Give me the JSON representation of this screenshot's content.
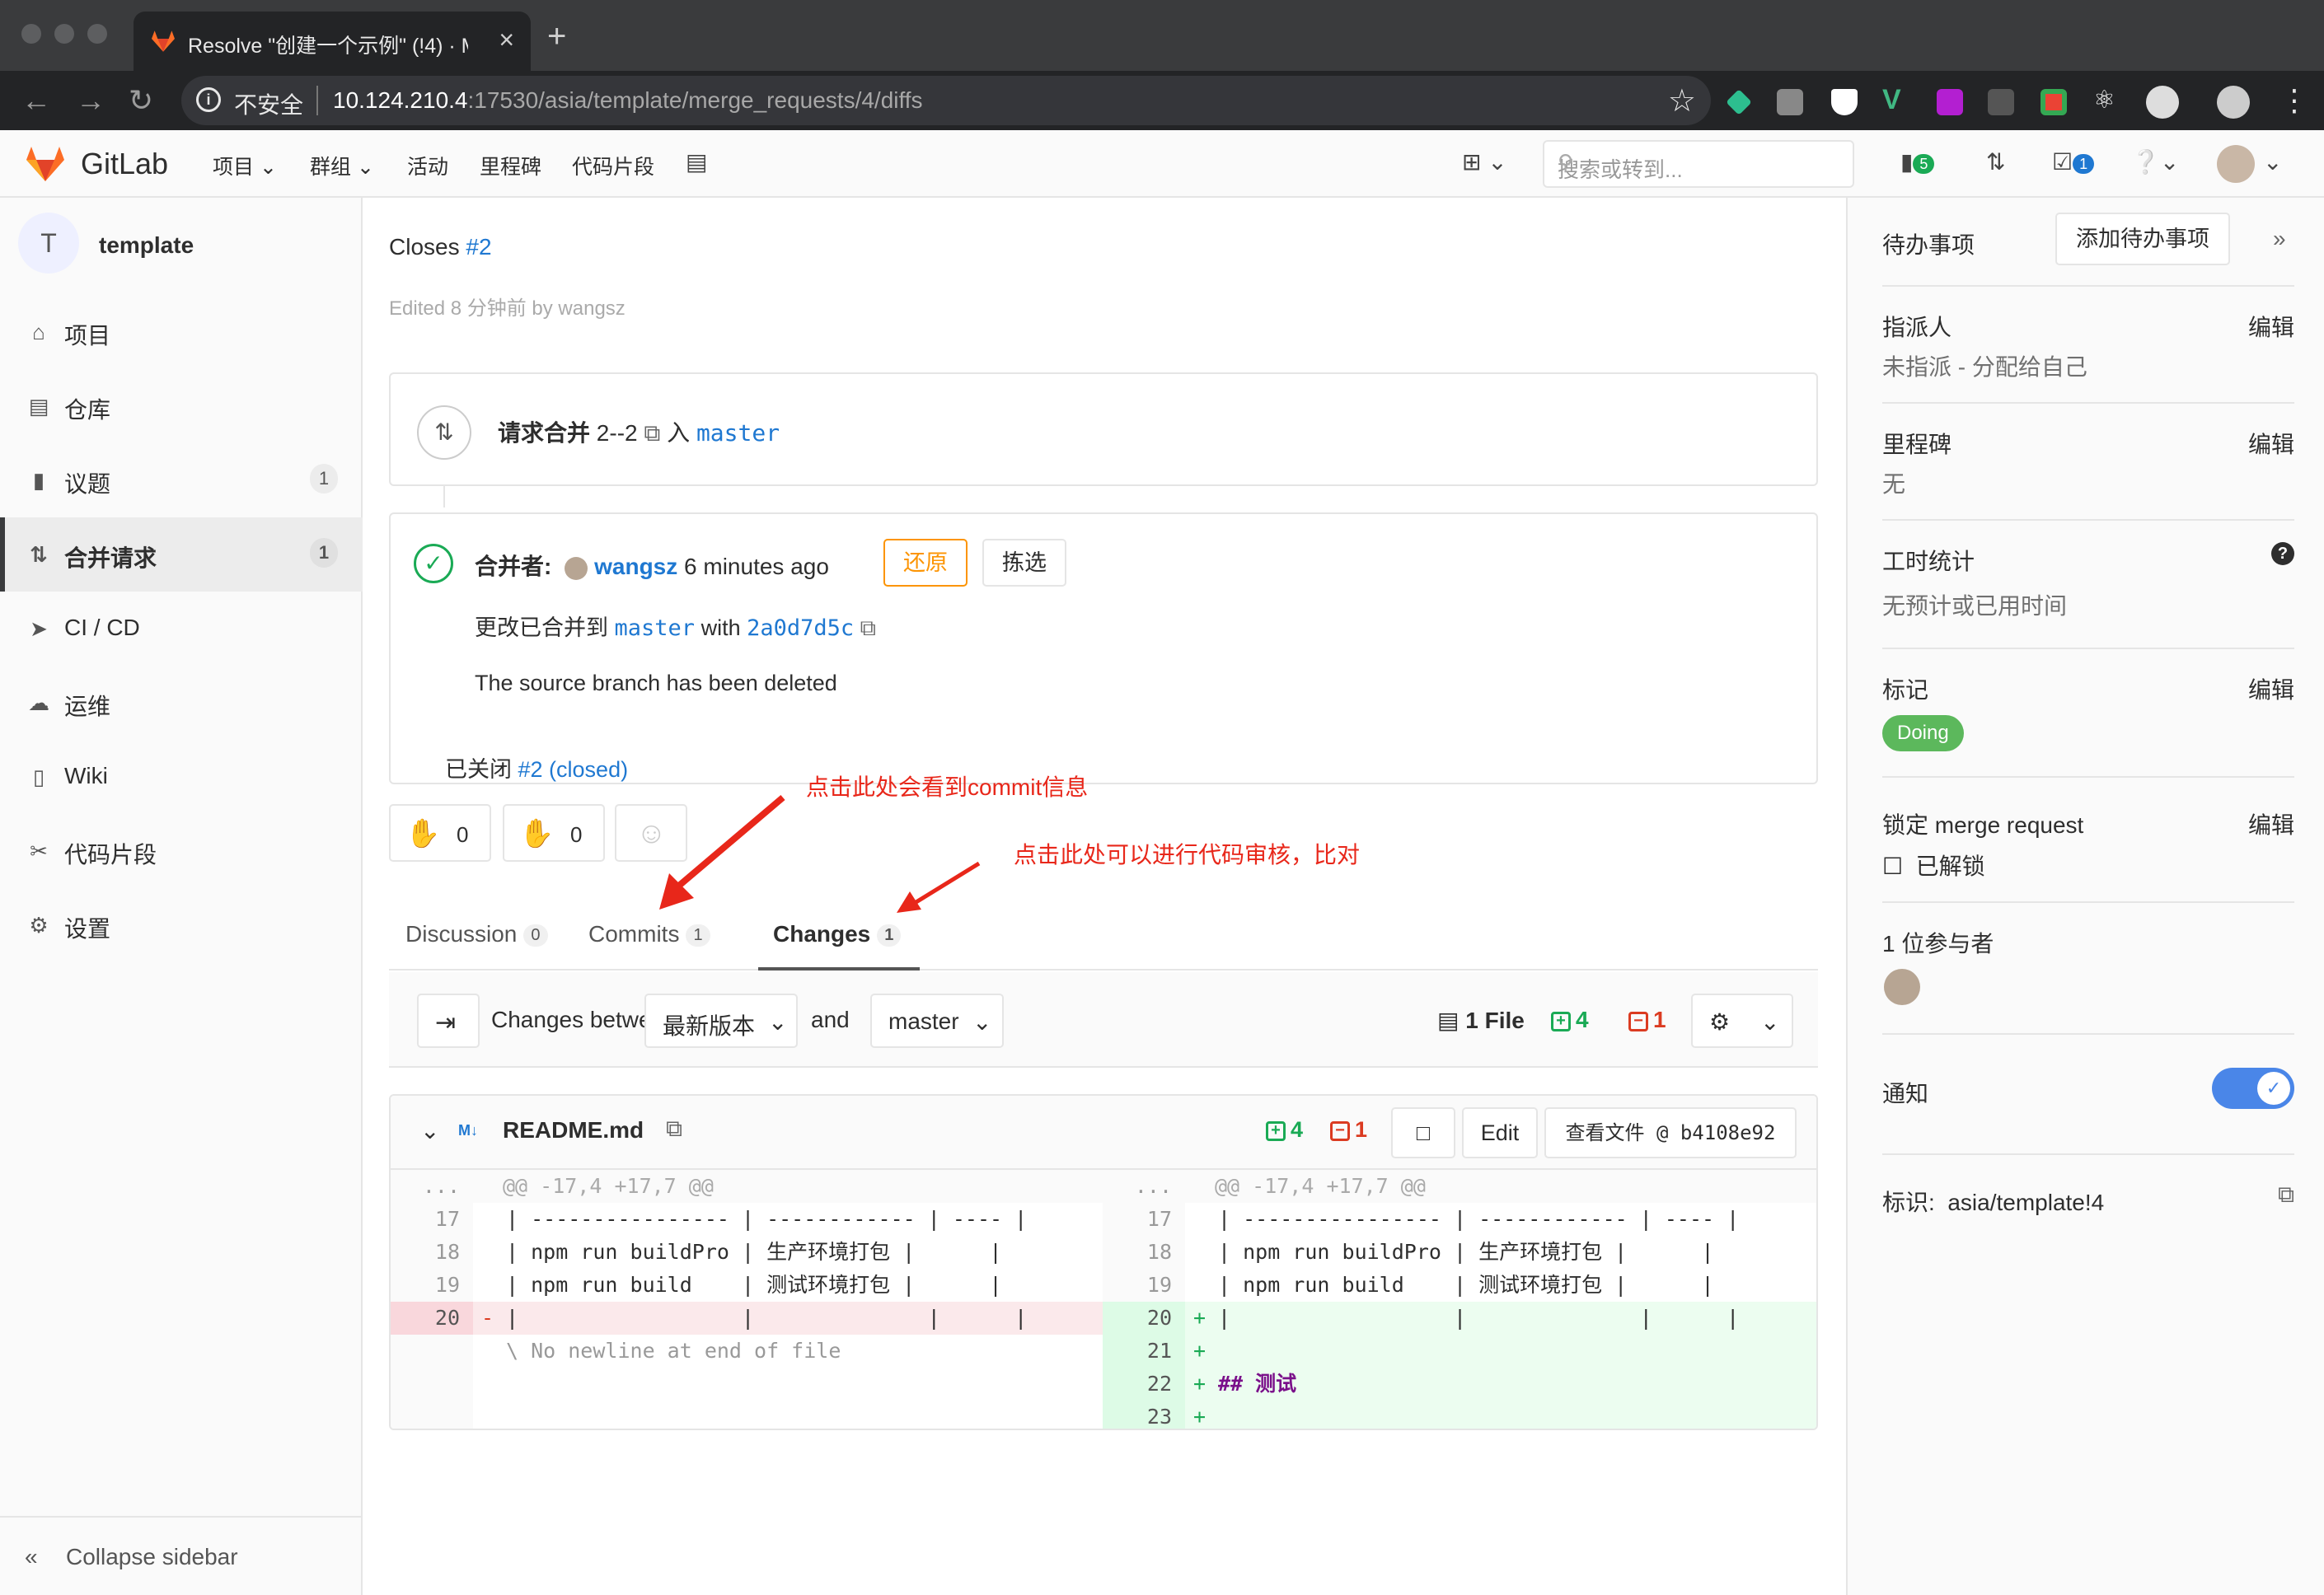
{
  "browser": {
    "tab_title": "Resolve \"创建一个示例\" (!4) · M",
    "tab_close": "×",
    "new_tab": "+",
    "insecure_label": "不安全",
    "url_host": "10.124.210.4",
    "url_rest": ":17530/asia/template/merge_requests/4/diffs"
  },
  "header": {
    "brand": "GitLab",
    "menu": [
      "项目",
      "群组",
      "活动",
      "里程碑",
      "代码片段"
    ],
    "search_placeholder": "搜索或转到...",
    "issues_badge": "5",
    "todos_badge": "1"
  },
  "sidebar": {
    "project_initial": "T",
    "project_name": "template",
    "items": [
      {
        "label": "项目",
        "icon": "home-icon",
        "count": ""
      },
      {
        "label": "仓库",
        "icon": "doc-icon",
        "count": ""
      },
      {
        "label": "议题",
        "icon": "issues-icon",
        "count": "1"
      },
      {
        "label": "合并请求",
        "icon": "merge-icon",
        "count": "1"
      },
      {
        "label": "CI / CD",
        "icon": "rocket-icon",
        "count": ""
      },
      {
        "label": "运维",
        "icon": "cloud-icon",
        "count": ""
      },
      {
        "label": "Wiki",
        "icon": "book-icon",
        "count": ""
      },
      {
        "label": "代码片段",
        "icon": "scissors-icon",
        "count": ""
      },
      {
        "label": "设置",
        "icon": "gear-icon",
        "count": ""
      }
    ],
    "collapse": "Collapse sidebar"
  },
  "main": {
    "closes_prefix": "Closes ",
    "closes_link": "#2",
    "edited": "Edited 8 分钟前 by wangsz",
    "mr_title": "请求合并",
    "mr_branch": "2--2",
    "mr_into": "入",
    "mr_target": "master",
    "merged_by_label": "合并者:",
    "merged_by_user": "wangsz",
    "merged_time": "6 minutes ago",
    "revert_btn": "还原",
    "cherry_btn": "拣选",
    "merged_into_prefix": "更改已合并到",
    "merged_into_branch": "master",
    "merged_with": "with",
    "merged_commit": "2a0d7d5c",
    "source_deleted": "The source branch has been deleted",
    "closed_prefix": "已关闭",
    "closed_link": "#2 (closed)",
    "thumbs_up": "0",
    "thumbs_down": "0",
    "tabs": [
      {
        "label": "Discussion",
        "count": "0"
      },
      {
        "label": "Commits",
        "count": "1"
      },
      {
        "label": "Changes",
        "count": "1"
      }
    ],
    "changes_between": "Changes between",
    "version_select": "最新版本",
    "and": "and",
    "target_select": "master",
    "files_count": "1 File",
    "additions": "4",
    "deletions": "1",
    "file": {
      "name": "README.md",
      "additions": "4",
      "deletions": "1",
      "edit_btn": "Edit",
      "view_btn": "查看文件 @ b4108e92",
      "hunk": "@@ -17,4 +17,7 @@",
      "left": [
        {
          "n": "17",
          "t": "| ---------------- | ------------ | ---- |",
          "kind": "ctx"
        },
        {
          "n": "18",
          "t": "| npm run buildPro | 生产环境打包 |      |",
          "kind": "ctx"
        },
        {
          "n": "19",
          "t": "| npm run build    | 测试环境打包 |      |",
          "kind": "ctx"
        },
        {
          "n": "20",
          "t": "|                  |              |      |",
          "kind": "del"
        },
        {
          "n": "",
          "t": "\\ No newline at end of file",
          "kind": "meta"
        }
      ],
      "right": [
        {
          "n": "17",
          "t": "| ---------------- | ------------ | ---- |",
          "kind": "ctx"
        },
        {
          "n": "18",
          "t": "| npm run buildPro | 生产环境打包 |      |",
          "kind": "ctx"
        },
        {
          "n": "19",
          "t": "| npm run build    | 测试环境打包 |      |",
          "kind": "ctx"
        },
        {
          "n": "20",
          "t": "|                  |              |      |",
          "kind": "add"
        },
        {
          "n": "21",
          "t": "",
          "kind": "add"
        },
        {
          "n": "22",
          "t": "## 测试",
          "kind": "add"
        },
        {
          "n": "23",
          "t": "",
          "kind": "add"
        }
      ]
    }
  },
  "annotations": {
    "commits_note": "点击此处会看到commit信息",
    "changes_note": "点击此处可以进行代码审核，比对"
  },
  "right_sidebar": {
    "todo": "待办事项",
    "add_todo": "添加待办事项",
    "assignee_title": "指派人",
    "assignee_value": "未指派 - 分配给自己",
    "milestone_title": "里程碑",
    "milestone_value": "无",
    "time_title": "工时统计",
    "time_value": "无预计或已用时间",
    "labels_title": "标记",
    "label_doing": "Doing",
    "lock_title": "锁定 merge request",
    "lock_value": "已解锁",
    "participants": "1 位参与者",
    "notify": "通知",
    "ref_label": "标识:",
    "ref_value": "asia/template!4",
    "edit": "编辑"
  },
  "colors": {
    "link": "#1f78d1",
    "success": "#1aaa55",
    "danger": "#db3b21",
    "warning": "#fc9403",
    "annotation": "#e8271a",
    "toggle": "#4a86e8"
  }
}
